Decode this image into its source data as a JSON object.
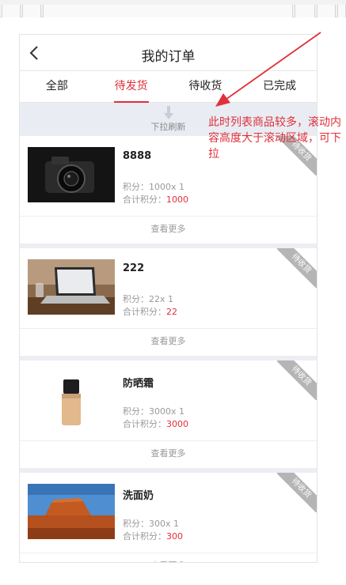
{
  "header": {
    "title": "我的订单"
  },
  "tabs": [
    {
      "label": "全部"
    },
    {
      "label": "待发货"
    },
    {
      "label": "待收货"
    },
    {
      "label": "已完成"
    }
  ],
  "refresh": {
    "label": "下拉刷新"
  },
  "orders": [
    {
      "name": "8888",
      "points_line": "积分：1000x 1",
      "total_label": "合计积分：",
      "total_value": "1000",
      "status": "待收货",
      "more": "查看更多",
      "thumb": "camera"
    },
    {
      "name": "222",
      "points_line": "积分：22x 1",
      "total_label": "合计积分：",
      "total_value": "22",
      "status": "待收货",
      "more": "查看更多",
      "thumb": "laptop"
    },
    {
      "name": "防晒霜",
      "points_line": "积分：3000x 1",
      "total_label": "合计积分：",
      "total_value": "3000",
      "status": "待收货",
      "more": "查看更多",
      "thumb": "bottle"
    },
    {
      "name": "洗面奶",
      "points_line": "积分：300x 1",
      "total_label": "合计积分：",
      "total_value": "300",
      "status": "待收货",
      "more": "查看更多",
      "thumb": "desert"
    }
  ],
  "annotation": {
    "text": "此时列表商品较多，滚动内容高度大于滚动区域，可下拉"
  },
  "colors": {
    "accent": "#e0303a",
    "refresh_bg": "#e9ecf3"
  }
}
